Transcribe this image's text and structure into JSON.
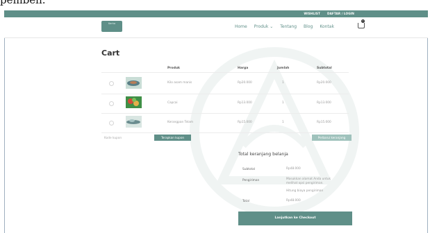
{
  "caption": "pembeli.",
  "topbar": {
    "wishlist": "WISHLIST",
    "auth": "DAFTAR / LOGIN"
  },
  "logo": {
    "name": "Kerka"
  },
  "nav": {
    "items": [
      "Home",
      "Produk ⌄",
      "Tentang",
      "Blog",
      "Kontak"
    ],
    "cart_count": "0"
  },
  "cart": {
    "title": "Cart",
    "columns": {
      "product": "Produk",
      "price": "Harga",
      "qty": "Jumlah",
      "subtotal": "Subtotal"
    },
    "rows": [
      {
        "name": "Kilo asam manis",
        "price": "Rp20.000",
        "qty": "1",
        "subtotal": "Rp20.000"
      },
      {
        "name": "Capcai",
        "price": "Rp13.000",
        "qty": "1",
        "subtotal": "Rp13.000"
      },
      {
        "name": "Kerangpan Telam",
        "price": "Rp15.000",
        "qty": "1",
        "subtotal": "Rp15.000"
      }
    ],
    "coupon_label": "Kode kupon",
    "apply_coupon": "Terapkan kupon",
    "update_cart": "Perbarui keranjang"
  },
  "totals": {
    "title": "Total keranjang belanja",
    "subtotal_label": "Subtotal",
    "subtotal_value": "Rp48.000",
    "shipping_label": "Pengiriman",
    "shipping_text": "Masukkan alamat Anda untuk melihat opsi pengiriman.",
    "shipping_link": "Hitung biaya pengiriman",
    "total_label": "Total",
    "total_value": "Rp48.000",
    "checkout": "Lanjutkan ke Checkout"
  },
  "colors": {
    "accent": "#5f8f88",
    "accent_light": "#9fc2bc"
  }
}
